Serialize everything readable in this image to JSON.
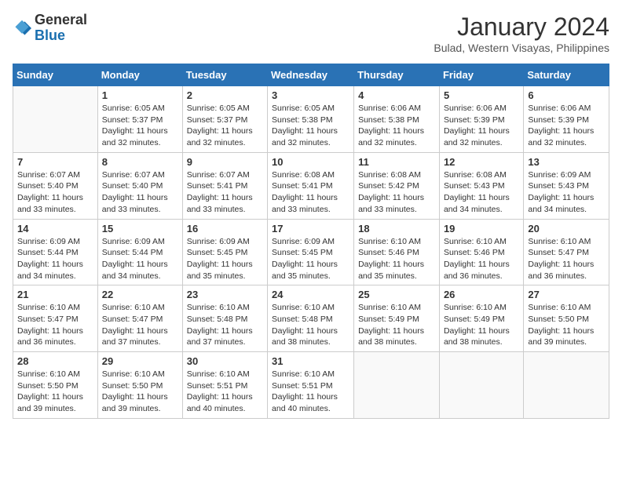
{
  "header": {
    "logo_general": "General",
    "logo_blue": "Blue",
    "month": "January 2024",
    "location": "Bulad, Western Visayas, Philippines"
  },
  "days_of_week": [
    "Sunday",
    "Monday",
    "Tuesday",
    "Wednesday",
    "Thursday",
    "Friday",
    "Saturday"
  ],
  "weeks": [
    [
      {
        "day": "",
        "empty": true
      },
      {
        "day": "1",
        "sunrise": "6:05 AM",
        "sunset": "5:37 PM",
        "daylight": "11 hours and 32 minutes."
      },
      {
        "day": "2",
        "sunrise": "6:05 AM",
        "sunset": "5:37 PM",
        "daylight": "11 hours and 32 minutes."
      },
      {
        "day": "3",
        "sunrise": "6:05 AM",
        "sunset": "5:38 PM",
        "daylight": "11 hours and 32 minutes."
      },
      {
        "day": "4",
        "sunrise": "6:06 AM",
        "sunset": "5:38 PM",
        "daylight": "11 hours and 32 minutes."
      },
      {
        "day": "5",
        "sunrise": "6:06 AM",
        "sunset": "5:39 PM",
        "daylight": "11 hours and 32 minutes."
      },
      {
        "day": "6",
        "sunrise": "6:06 AM",
        "sunset": "5:39 PM",
        "daylight": "11 hours and 32 minutes."
      }
    ],
    [
      {
        "day": "7",
        "sunrise": "6:07 AM",
        "sunset": "5:40 PM",
        "daylight": "11 hours and 33 minutes."
      },
      {
        "day": "8",
        "sunrise": "6:07 AM",
        "sunset": "5:40 PM",
        "daylight": "11 hours and 33 minutes."
      },
      {
        "day": "9",
        "sunrise": "6:07 AM",
        "sunset": "5:41 PM",
        "daylight": "11 hours and 33 minutes."
      },
      {
        "day": "10",
        "sunrise": "6:08 AM",
        "sunset": "5:41 PM",
        "daylight": "11 hours and 33 minutes."
      },
      {
        "day": "11",
        "sunrise": "6:08 AM",
        "sunset": "5:42 PM",
        "daylight": "11 hours and 33 minutes."
      },
      {
        "day": "12",
        "sunrise": "6:08 AM",
        "sunset": "5:43 PM",
        "daylight": "11 hours and 34 minutes."
      },
      {
        "day": "13",
        "sunrise": "6:09 AM",
        "sunset": "5:43 PM",
        "daylight": "11 hours and 34 minutes."
      }
    ],
    [
      {
        "day": "14",
        "sunrise": "6:09 AM",
        "sunset": "5:44 PM",
        "daylight": "11 hours and 34 minutes."
      },
      {
        "day": "15",
        "sunrise": "6:09 AM",
        "sunset": "5:44 PM",
        "daylight": "11 hours and 34 minutes."
      },
      {
        "day": "16",
        "sunrise": "6:09 AM",
        "sunset": "5:45 PM",
        "daylight": "11 hours and 35 minutes."
      },
      {
        "day": "17",
        "sunrise": "6:09 AM",
        "sunset": "5:45 PM",
        "daylight": "11 hours and 35 minutes."
      },
      {
        "day": "18",
        "sunrise": "6:10 AM",
        "sunset": "5:46 PM",
        "daylight": "11 hours and 35 minutes."
      },
      {
        "day": "19",
        "sunrise": "6:10 AM",
        "sunset": "5:46 PM",
        "daylight": "11 hours and 36 minutes."
      },
      {
        "day": "20",
        "sunrise": "6:10 AM",
        "sunset": "5:47 PM",
        "daylight": "11 hours and 36 minutes."
      }
    ],
    [
      {
        "day": "21",
        "sunrise": "6:10 AM",
        "sunset": "5:47 PM",
        "daylight": "11 hours and 36 minutes."
      },
      {
        "day": "22",
        "sunrise": "6:10 AM",
        "sunset": "5:47 PM",
        "daylight": "11 hours and 37 minutes."
      },
      {
        "day": "23",
        "sunrise": "6:10 AM",
        "sunset": "5:48 PM",
        "daylight": "11 hours and 37 minutes."
      },
      {
        "day": "24",
        "sunrise": "6:10 AM",
        "sunset": "5:48 PM",
        "daylight": "11 hours and 38 minutes."
      },
      {
        "day": "25",
        "sunrise": "6:10 AM",
        "sunset": "5:49 PM",
        "daylight": "11 hours and 38 minutes."
      },
      {
        "day": "26",
        "sunrise": "6:10 AM",
        "sunset": "5:49 PM",
        "daylight": "11 hours and 38 minutes."
      },
      {
        "day": "27",
        "sunrise": "6:10 AM",
        "sunset": "5:50 PM",
        "daylight": "11 hours and 39 minutes."
      }
    ],
    [
      {
        "day": "28",
        "sunrise": "6:10 AM",
        "sunset": "5:50 PM",
        "daylight": "11 hours and 39 minutes."
      },
      {
        "day": "29",
        "sunrise": "6:10 AM",
        "sunset": "5:50 PM",
        "daylight": "11 hours and 39 minutes."
      },
      {
        "day": "30",
        "sunrise": "6:10 AM",
        "sunset": "5:51 PM",
        "daylight": "11 hours and 40 minutes."
      },
      {
        "day": "31",
        "sunrise": "6:10 AM",
        "sunset": "5:51 PM",
        "daylight": "11 hours and 40 minutes."
      },
      {
        "day": "",
        "empty": true
      },
      {
        "day": "",
        "empty": true
      },
      {
        "day": "",
        "empty": true
      }
    ]
  ]
}
